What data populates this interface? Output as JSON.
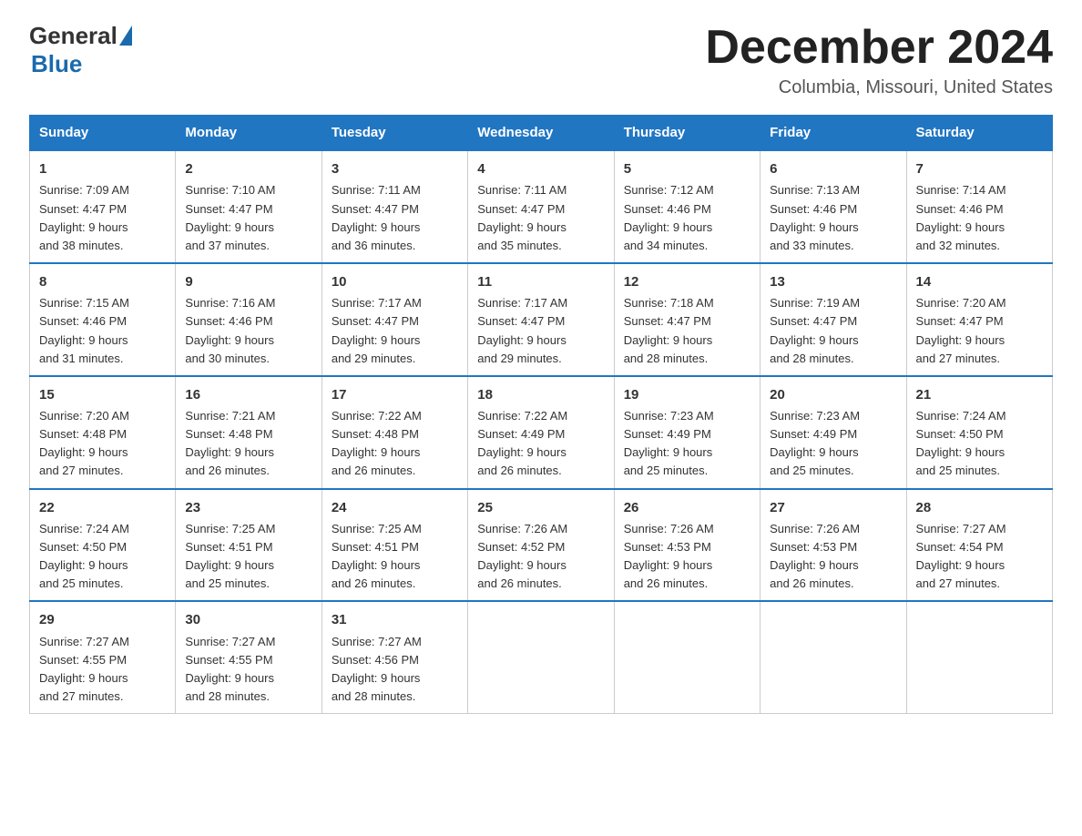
{
  "header": {
    "logo_general": "General",
    "logo_blue": "Blue",
    "month_title": "December 2024",
    "location": "Columbia, Missouri, United States"
  },
  "days_of_week": [
    "Sunday",
    "Monday",
    "Tuesday",
    "Wednesday",
    "Thursday",
    "Friday",
    "Saturday"
  ],
  "weeks": [
    [
      {
        "day": "1",
        "sunrise": "7:09 AM",
        "sunset": "4:47 PM",
        "daylight": "9 hours and 38 minutes."
      },
      {
        "day": "2",
        "sunrise": "7:10 AM",
        "sunset": "4:47 PM",
        "daylight": "9 hours and 37 minutes."
      },
      {
        "day": "3",
        "sunrise": "7:11 AM",
        "sunset": "4:47 PM",
        "daylight": "9 hours and 36 minutes."
      },
      {
        "day": "4",
        "sunrise": "7:11 AM",
        "sunset": "4:47 PM",
        "daylight": "9 hours and 35 minutes."
      },
      {
        "day": "5",
        "sunrise": "7:12 AM",
        "sunset": "4:46 PM",
        "daylight": "9 hours and 34 minutes."
      },
      {
        "day": "6",
        "sunrise": "7:13 AM",
        "sunset": "4:46 PM",
        "daylight": "9 hours and 33 minutes."
      },
      {
        "day": "7",
        "sunrise": "7:14 AM",
        "sunset": "4:46 PM",
        "daylight": "9 hours and 32 minutes."
      }
    ],
    [
      {
        "day": "8",
        "sunrise": "7:15 AM",
        "sunset": "4:46 PM",
        "daylight": "9 hours and 31 minutes."
      },
      {
        "day": "9",
        "sunrise": "7:16 AM",
        "sunset": "4:46 PM",
        "daylight": "9 hours and 30 minutes."
      },
      {
        "day": "10",
        "sunrise": "7:17 AM",
        "sunset": "4:47 PM",
        "daylight": "9 hours and 29 minutes."
      },
      {
        "day": "11",
        "sunrise": "7:17 AM",
        "sunset": "4:47 PM",
        "daylight": "9 hours and 29 minutes."
      },
      {
        "day": "12",
        "sunrise": "7:18 AM",
        "sunset": "4:47 PM",
        "daylight": "9 hours and 28 minutes."
      },
      {
        "day": "13",
        "sunrise": "7:19 AM",
        "sunset": "4:47 PM",
        "daylight": "9 hours and 28 minutes."
      },
      {
        "day": "14",
        "sunrise": "7:20 AM",
        "sunset": "4:47 PM",
        "daylight": "9 hours and 27 minutes."
      }
    ],
    [
      {
        "day": "15",
        "sunrise": "7:20 AM",
        "sunset": "4:48 PM",
        "daylight": "9 hours and 27 minutes."
      },
      {
        "day": "16",
        "sunrise": "7:21 AM",
        "sunset": "4:48 PM",
        "daylight": "9 hours and 26 minutes."
      },
      {
        "day": "17",
        "sunrise": "7:22 AM",
        "sunset": "4:48 PM",
        "daylight": "9 hours and 26 minutes."
      },
      {
        "day": "18",
        "sunrise": "7:22 AM",
        "sunset": "4:49 PM",
        "daylight": "9 hours and 26 minutes."
      },
      {
        "day": "19",
        "sunrise": "7:23 AM",
        "sunset": "4:49 PM",
        "daylight": "9 hours and 25 minutes."
      },
      {
        "day": "20",
        "sunrise": "7:23 AM",
        "sunset": "4:49 PM",
        "daylight": "9 hours and 25 minutes."
      },
      {
        "day": "21",
        "sunrise": "7:24 AM",
        "sunset": "4:50 PM",
        "daylight": "9 hours and 25 minutes."
      }
    ],
    [
      {
        "day": "22",
        "sunrise": "7:24 AM",
        "sunset": "4:50 PM",
        "daylight": "9 hours and 25 minutes."
      },
      {
        "day": "23",
        "sunrise": "7:25 AM",
        "sunset": "4:51 PM",
        "daylight": "9 hours and 25 minutes."
      },
      {
        "day": "24",
        "sunrise": "7:25 AM",
        "sunset": "4:51 PM",
        "daylight": "9 hours and 26 minutes."
      },
      {
        "day": "25",
        "sunrise": "7:26 AM",
        "sunset": "4:52 PM",
        "daylight": "9 hours and 26 minutes."
      },
      {
        "day": "26",
        "sunrise": "7:26 AM",
        "sunset": "4:53 PM",
        "daylight": "9 hours and 26 minutes."
      },
      {
        "day": "27",
        "sunrise": "7:26 AM",
        "sunset": "4:53 PM",
        "daylight": "9 hours and 26 minutes."
      },
      {
        "day": "28",
        "sunrise": "7:27 AM",
        "sunset": "4:54 PM",
        "daylight": "9 hours and 27 minutes."
      }
    ],
    [
      {
        "day": "29",
        "sunrise": "7:27 AM",
        "sunset": "4:55 PM",
        "daylight": "9 hours and 27 minutes."
      },
      {
        "day": "30",
        "sunrise": "7:27 AM",
        "sunset": "4:55 PM",
        "daylight": "9 hours and 28 minutes."
      },
      {
        "day": "31",
        "sunrise": "7:27 AM",
        "sunset": "4:56 PM",
        "daylight": "9 hours and 28 minutes."
      },
      null,
      null,
      null,
      null
    ]
  ]
}
